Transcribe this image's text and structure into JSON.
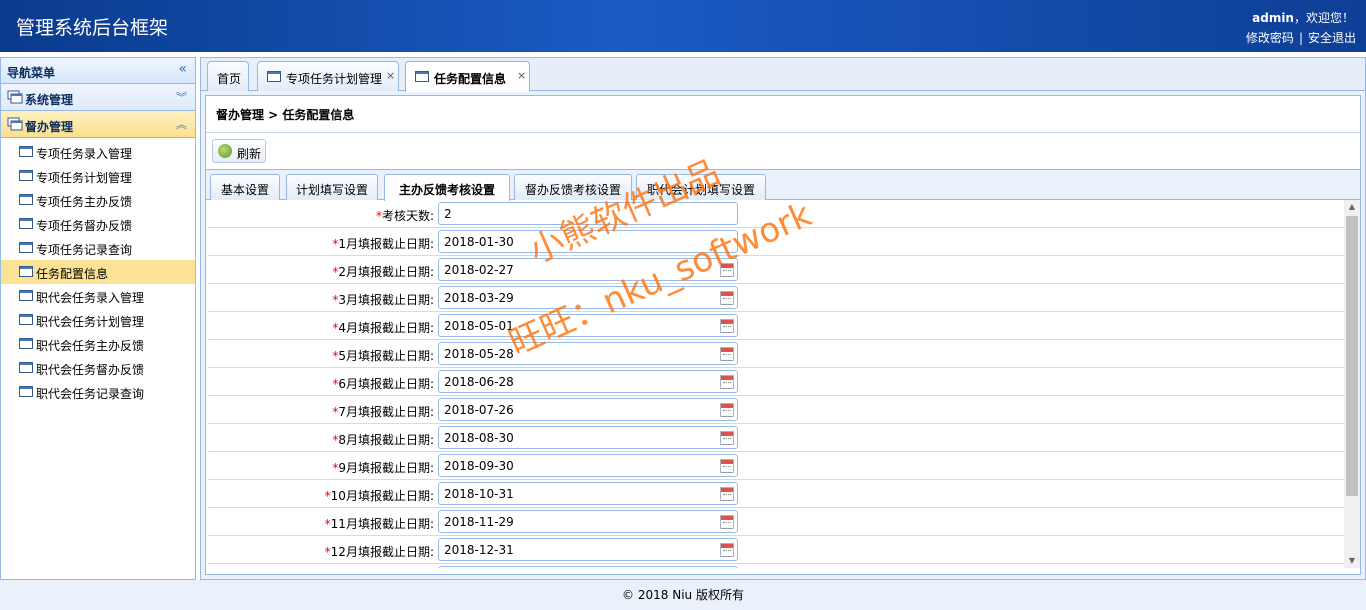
{
  "header": {
    "title": "管理系统后台框架",
    "user": "admin",
    "greeting": "，欢迎您！",
    "change_password": "修改密码",
    "separator": "|",
    "logout": "安全退出"
  },
  "sidebar": {
    "title": "导航菜单",
    "collapse_glyph": "«",
    "groups": [
      {
        "label": "系统管理",
        "arrow": "︾"
      },
      {
        "label": "督办管理",
        "arrow": "︽"
      }
    ],
    "items": [
      "专项任务录入管理",
      "专项任务计划管理",
      "专项任务主办反馈",
      "专项任务督办反馈",
      "专项任务记录查询",
      "任务配置信息",
      "职代会任务录入管理",
      "职代会任务计划管理",
      "职代会任务主办反馈",
      "职代会任务督办反馈",
      "职代会任务记录查询"
    ]
  },
  "tabs": {
    "home": "首页",
    "plan": "专项任务计划管理",
    "config": "任务配置信息",
    "close": "×"
  },
  "breadcrumb": "督办管理 > 任务配置信息",
  "toolbar": {
    "refresh": "刷新"
  },
  "subtabs": [
    "基本设置",
    "计划填写设置",
    "主办反馈考核设置",
    "督办反馈考核设置",
    "职代会计划填写设置"
  ],
  "form": {
    "required_mark": "*",
    "rows": [
      {
        "label": "考核天数:",
        "value": "2"
      },
      {
        "label": "1月填报截止日期:",
        "value": "2018-01-30"
      },
      {
        "label": "2月填报截止日期:",
        "value": "2018-02-27"
      },
      {
        "label": "3月填报截止日期:",
        "value": "2018-03-29"
      },
      {
        "label": "4月填报截止日期:",
        "value": "2018-05-01"
      },
      {
        "label": "5月填报截止日期:",
        "value": "2018-05-28"
      },
      {
        "label": "6月填报截止日期:",
        "value": "2018-06-28"
      },
      {
        "label": "7月填报截止日期:",
        "value": "2018-07-26"
      },
      {
        "label": "8月填报截止日期:",
        "value": "2018-08-30"
      },
      {
        "label": "9月填报截止日期:",
        "value": "2018-09-30"
      },
      {
        "label": "10月填报截止日期:",
        "value": "2018-10-31"
      },
      {
        "label": "11月填报截止日期:",
        "value": "2018-11-29"
      },
      {
        "label": "12月填报截止日期:",
        "value": "2018-12-31"
      }
    ]
  },
  "watermark": {
    "line1": "小熊软件出品",
    "line2": "旺旺：nku_softwork"
  },
  "footer": "© 2018 Niu 版权所有"
}
